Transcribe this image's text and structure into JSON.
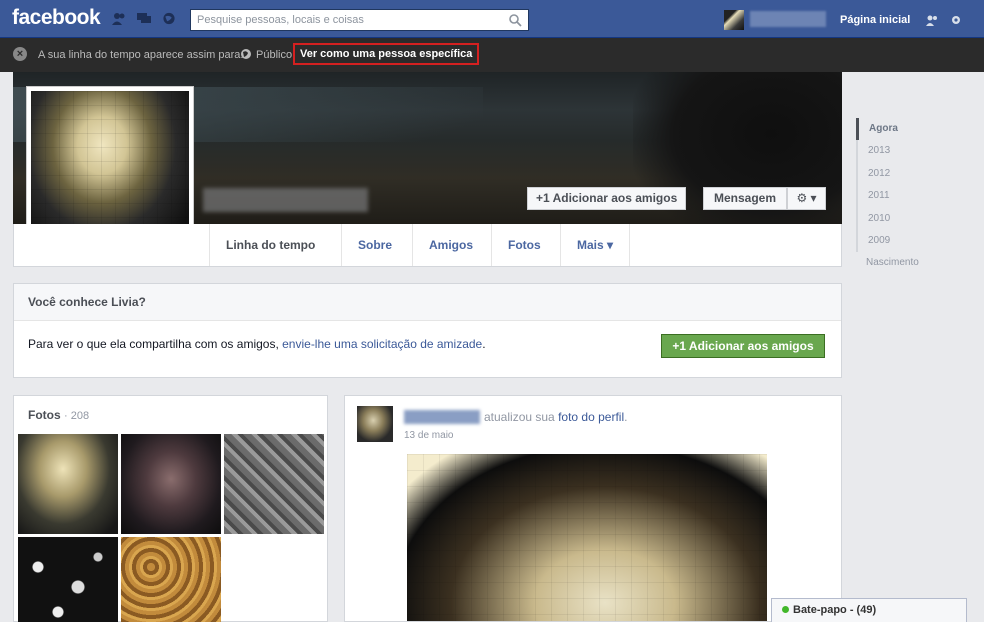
{
  "header": {
    "logo": "facebook",
    "search_placeholder": "Pesquise pessoas, locais e coisas",
    "home_label": "Página inicial"
  },
  "view_as": {
    "text": "A sua linha do tempo aparece assim para:",
    "audience": "Público",
    "specific_button": "Ver como uma pessoa específica"
  },
  "cover": {
    "add_friend": "+1 Adicionar aos amigos",
    "message": "Mensagem",
    "gear": "⚙ ▾"
  },
  "tabs": [
    {
      "label": "Linha do tempo"
    },
    {
      "label": "Sobre"
    },
    {
      "label": "Amigos"
    },
    {
      "label": "Fotos"
    },
    {
      "label": "Mais ▾"
    }
  ],
  "timeline_nav": [
    "Agora",
    "2013",
    "2012",
    "2011",
    "2010",
    "2009",
    "Nascimento"
  ],
  "know_card": {
    "title": "Você conhece Livia?",
    "text_before": "Para ver o que ela compartilha com os amigos, ",
    "link": "envie-lhe uma solicitação de amizade",
    "text_after": ".",
    "button": "+1 Adicionar aos amigos"
  },
  "photos": {
    "title": "Fotos",
    "count": "· 208"
  },
  "post": {
    "action_text": "atualizou sua ",
    "action_link": "foto do perfil",
    "action_end": ".",
    "date": "13 de maio"
  },
  "chat": {
    "label": "Bate-papo - (49)"
  },
  "colors": {
    "brand": "#3b5998",
    "highlight_border": "#d42020",
    "green_button": "#69a74e"
  }
}
